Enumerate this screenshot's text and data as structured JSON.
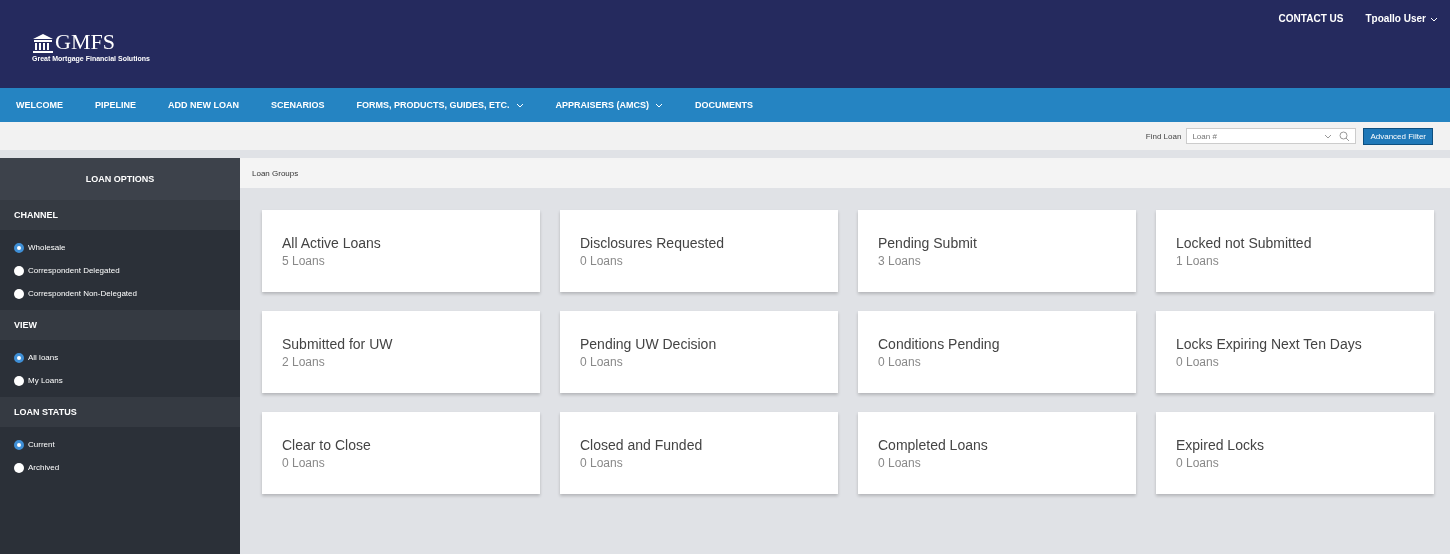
{
  "logo": {
    "name": "GMFS",
    "tagline": "Great Mortgage Financial Solutions"
  },
  "top_links": [
    {
      "label": "CONTACT US",
      "dropdown": false
    },
    {
      "label": "Tpoallo User",
      "dropdown": true
    }
  ],
  "nav": [
    {
      "label": "WELCOME",
      "dropdown": false
    },
    {
      "label": "PIPELINE",
      "dropdown": false
    },
    {
      "label": "ADD NEW LOAN",
      "dropdown": false
    },
    {
      "label": "SCENARIOS",
      "dropdown": false
    },
    {
      "label": "FORMS, PRODUCTS, GUIDES, ETC.",
      "dropdown": true
    },
    {
      "label": "APPRAISERS (AMCS)",
      "dropdown": true
    },
    {
      "label": "DOCUMENTS",
      "dropdown": false
    }
  ],
  "find_loan": {
    "label": "Find Loan",
    "placeholder": "Loan #",
    "button": "Advanced Filter"
  },
  "sidebar": {
    "title": "LOAN OPTIONS",
    "sections": [
      {
        "title": "CHANNEL",
        "options": [
          {
            "label": "Wholesale",
            "selected": true
          },
          {
            "label": "Correspondent Delegated",
            "selected": false
          },
          {
            "label": "Correspondent Non-Delegated",
            "selected": false
          }
        ]
      },
      {
        "title": "VIEW",
        "options": [
          {
            "label": "All loans",
            "selected": true
          },
          {
            "label": "My Loans",
            "selected": false
          }
        ]
      },
      {
        "title": "LOAN STATUS",
        "options": [
          {
            "label": "Current",
            "selected": true
          },
          {
            "label": "Archived",
            "selected": false
          }
        ]
      }
    ]
  },
  "breadcrumb": "Loan Groups",
  "groups": [
    {
      "title": "All Active Loans",
      "count": "5 Loans"
    },
    {
      "title": "Disclosures Requested",
      "count": "0 Loans"
    },
    {
      "title": "Pending Submit",
      "count": "3 Loans"
    },
    {
      "title": "Locked not Submitted",
      "count": "1 Loans"
    },
    {
      "title": "Submitted for UW",
      "count": "2 Loans"
    },
    {
      "title": "Pending UW Decision",
      "count": "0 Loans"
    },
    {
      "title": "Conditions Pending",
      "count": "0 Loans"
    },
    {
      "title": "Locks Expiring Next Ten Days",
      "count": "0 Loans"
    },
    {
      "title": "Clear to Close",
      "count": "0 Loans"
    },
    {
      "title": "Closed and Funded",
      "count": "0 Loans"
    },
    {
      "title": "Completed Loans",
      "count": "0 Loans"
    },
    {
      "title": "Expired Locks",
      "count": "0 Loans"
    }
  ]
}
